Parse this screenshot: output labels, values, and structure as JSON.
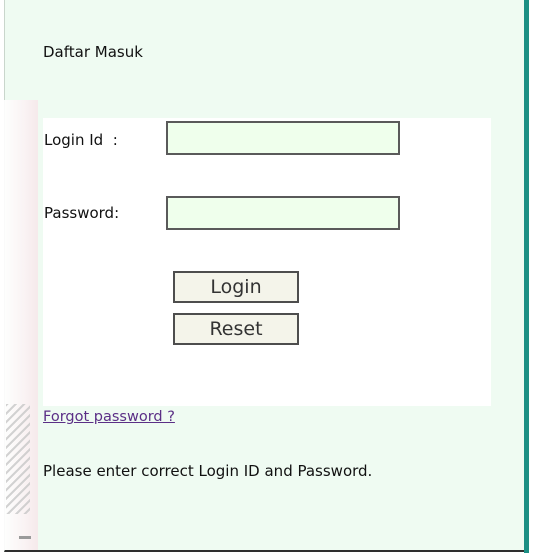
{
  "page": {
    "title": "Daftar Masuk"
  },
  "form": {
    "login_label": "Login Id  :",
    "login_value": "",
    "password_label": "Password:",
    "password_value": "",
    "login_button": "Login",
    "reset_button": "Reset"
  },
  "links": {
    "forgot_password": "Forgot password ?"
  },
  "message": {
    "text": "Please enter correct Login ID and Password."
  },
  "colors": {
    "panel_background": "#effbf2",
    "accent_bar": "#1c8f84",
    "input_background": "#efffec",
    "link": "#5b2f86"
  }
}
